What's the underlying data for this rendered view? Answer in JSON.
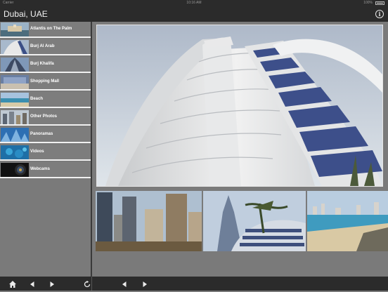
{
  "status_bar": {
    "carrier": "Carrier",
    "time": "10:16 AM",
    "battery": "100%"
  },
  "nav": {
    "title": "Dubai, UAE",
    "info_icon": "info-icon"
  },
  "sidebar": {
    "items": [
      {
        "label": "Atlantis on The Palm"
      },
      {
        "label": "Burj Al Arab"
      },
      {
        "label": "Burj Khalifa"
      },
      {
        "label": "Shopping Mall"
      },
      {
        "label": "Beach"
      },
      {
        "label": "Other Photos"
      },
      {
        "label": "Panoramas"
      },
      {
        "label": "Videos"
      },
      {
        "label": "Webcams"
      }
    ]
  },
  "toolbar": {
    "left_icons": [
      "home-icon",
      "previous-arrow-icon",
      "next-arrow-icon",
      "refresh-icon"
    ],
    "right_icons": [
      "previous-arrow-icon",
      "next-arrow-icon"
    ]
  },
  "colors": {
    "bar_background": "#2b2b2b",
    "panel_background": "#7a7a7a",
    "sky": "#c9d3df",
    "glass_blue": "#3d4f8a"
  }
}
